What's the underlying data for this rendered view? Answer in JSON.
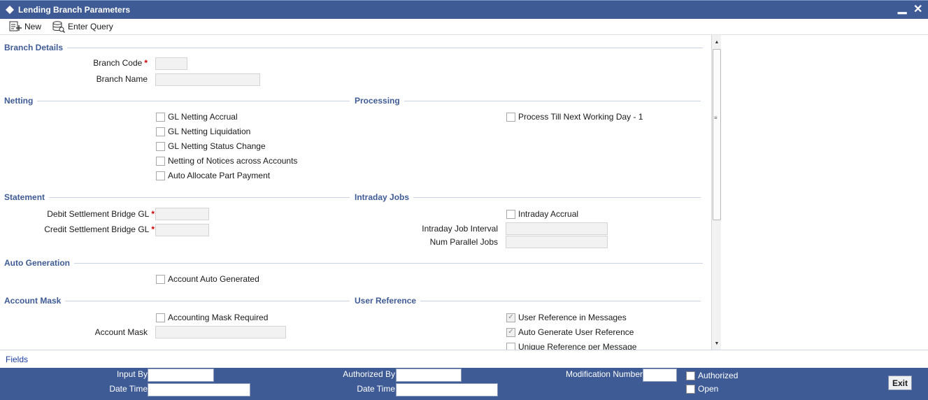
{
  "window": {
    "title": "Lending Branch Parameters",
    "minimize_glyph": "▁",
    "close_glyph": "✕"
  },
  "toolbar": {
    "new_label": "New",
    "enter_query_label": "Enter Query"
  },
  "branch_details": {
    "heading": "Branch Details",
    "branch_code_label": "Branch Code",
    "branch_code_value": "",
    "branch_name_label": "Branch Name",
    "branch_name_value": ""
  },
  "netting": {
    "heading": "Netting",
    "items": [
      {
        "label": "GL Netting Accrual",
        "checked": false
      },
      {
        "label": "GL Netting Liquidation",
        "checked": false
      },
      {
        "label": "GL Netting Status Change",
        "checked": false
      },
      {
        "label": "Netting of Notices across Accounts",
        "checked": false
      },
      {
        "label": "Auto Allocate Part Payment",
        "checked": false
      }
    ]
  },
  "processing": {
    "heading": "Processing",
    "items": [
      {
        "label": "Process Till Next Working Day - 1",
        "checked": false
      }
    ]
  },
  "statement": {
    "heading": "Statement",
    "debit_label": "Debit Settlement Bridge GL",
    "debit_value": "",
    "credit_label": "Credit Settlement Bridge GL",
    "credit_value": ""
  },
  "intraday_jobs": {
    "heading": "Intraday Jobs",
    "accrual_label": "Intraday Accrual",
    "accrual_checked": false,
    "interval_label": "Intraday Job Interval",
    "interval_value": "",
    "parallel_label": "Num Parallel Jobs",
    "parallel_value": ""
  },
  "auto_generation": {
    "heading": "Auto Generation",
    "account_auto_generated_label": "Account Auto Generated",
    "account_auto_generated_checked": false
  },
  "account_mask": {
    "heading": "Account Mask",
    "mask_required_label": "Accounting Mask Required",
    "mask_required_checked": false,
    "mask_label": "Account Mask",
    "mask_value": ""
  },
  "user_reference": {
    "heading": "User Reference",
    "items": [
      {
        "label": "User Reference in Messages",
        "checked": true,
        "disabled": true
      },
      {
        "label": "Auto Generate User Reference",
        "checked": true,
        "disabled": true
      },
      {
        "label": "Unique Reference per Message",
        "checked": false,
        "disabled": false
      }
    ]
  },
  "required_marker": "*",
  "check_glyph": "✓",
  "fields_link": "Fields",
  "audit": {
    "input_by_label": "Input By",
    "input_by_value": "",
    "date_time_label": "Date Time",
    "input_date_time_value": "",
    "authorized_by_label": "Authorized By",
    "authorized_by_value": "",
    "auth_date_time_value": "",
    "modification_number_label": "Modification Number",
    "modification_number_value": "",
    "authorized_label": "Authorized",
    "authorized_checked": false,
    "open_label": "Open",
    "open_checked": false,
    "exit_label": "Exit"
  },
  "colors": {
    "brand": "#3e5b95",
    "required": "#d00000",
    "link": "#1b3fa0"
  },
  "icons": {
    "window": "diamond-icon",
    "new": "new-document-icon",
    "query": "enter-query-icon"
  }
}
